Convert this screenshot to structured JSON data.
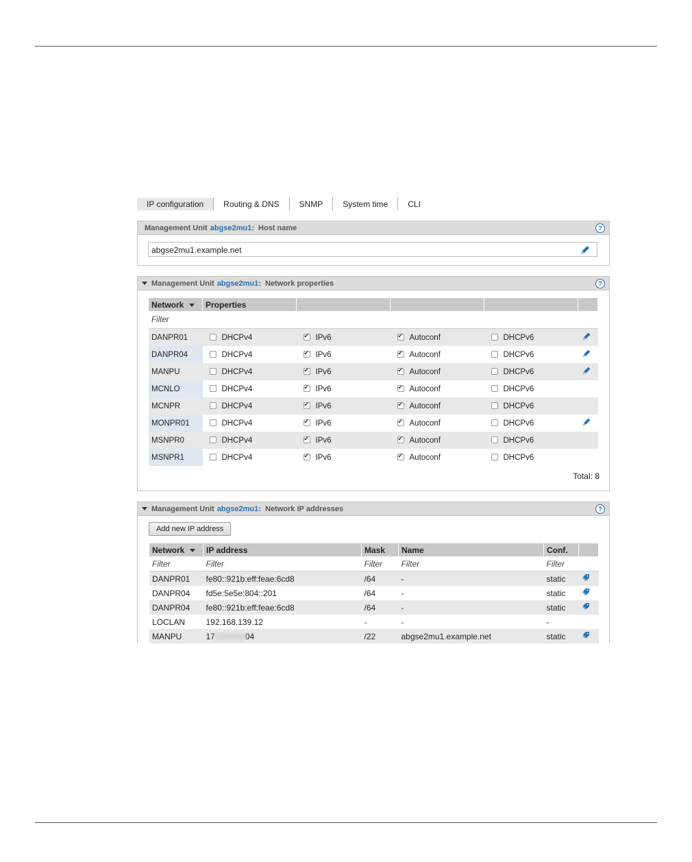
{
  "tabs": [
    "IP configuration",
    "Routing & DNS",
    "SNMP",
    "System time",
    "CLI"
  ],
  "host_panel": {
    "title_prefix": "Management Unit",
    "unit": "abgse2mu1",
    "title_suffix": ":  Host name",
    "host_value": "abgse2mu1.example.net"
  },
  "netprops_panel": {
    "title_prefix": "Management Unit",
    "unit": "abgse2mu1",
    "title_suffix": ":  Network properties",
    "col_network": "Network",
    "col_properties": "Properties",
    "filter_label": "Filter",
    "total": "Total: 8",
    "rows": [
      {
        "network": "DANPR01",
        "dhcpv4": false,
        "ipv6": true,
        "autoconf": true,
        "dhcpv6": false,
        "editable": true
      },
      {
        "network": "DANPR04",
        "dhcpv4": false,
        "ipv6": true,
        "autoconf": true,
        "dhcpv6": false,
        "editable": true
      },
      {
        "network": "MANPU",
        "dhcpv4": false,
        "ipv6": true,
        "autoconf": true,
        "dhcpv6": false,
        "editable": true
      },
      {
        "network": "MCNLO",
        "dhcpv4": false,
        "ipv6": true,
        "autoconf": true,
        "dhcpv6": false,
        "editable": false
      },
      {
        "network": "MCNPR",
        "dhcpv4": false,
        "ipv6": true,
        "autoconf": true,
        "dhcpv6": false,
        "editable": false
      },
      {
        "network": "MONPR01",
        "dhcpv4": false,
        "ipv6": true,
        "autoconf": true,
        "dhcpv6": false,
        "editable": true
      },
      {
        "network": "MSNPR0",
        "dhcpv4": false,
        "ipv6": true,
        "autoconf": true,
        "dhcpv6": false,
        "editable": false
      },
      {
        "network": "MSNPR1",
        "dhcpv4": false,
        "ipv6": true,
        "autoconf": true,
        "dhcpv6": false,
        "editable": false
      }
    ],
    "labels": {
      "dhcpv4": "DHCPv4",
      "ipv6": "IPv6",
      "autoconf": "Autoconf",
      "dhcpv6": "DHCPv6"
    }
  },
  "ipaddr_panel": {
    "title_prefix": "Management Unit",
    "unit": "abgse2mu1",
    "title_suffix": ":  Network IP addresses",
    "add_button": "Add new IP address",
    "columns": [
      "Network",
      "IP address",
      "Mask",
      "Name",
      "Conf."
    ],
    "filters": [
      "Filter",
      "Filter",
      "Filter",
      "Filter",
      "Filter"
    ],
    "rows": [
      {
        "network": "DANPR01",
        "ip": "fe80::921b:eff:feae:6cd8",
        "mask": "/64",
        "name": "-",
        "conf": "static",
        "edit": true
      },
      {
        "network": "DANPR04",
        "ip": "fd5e:5e5e:804::201",
        "mask": "/64",
        "name": "-",
        "conf": "static",
        "edit": true
      },
      {
        "network": "DANPR04",
        "ip": "fe80::921b:eff:feae:6cd8",
        "mask": "/64",
        "name": "-",
        "conf": "static",
        "edit": true
      },
      {
        "network": "LOCLAN",
        "ip": "192.168.139.12",
        "mask": "-",
        "name": "-",
        "conf": "-",
        "edit": false
      },
      {
        "network": "MANPU",
        "ip_prefix": "17",
        "ip_suffix": "04",
        "mask": "/22",
        "name": "abgse2mu1.example.net",
        "conf": "static",
        "edit": true
      }
    ]
  },
  "colors": {
    "accent": "#2a6fb0",
    "header_bg": "#dcdcdc",
    "table_header": "#c8c8c8",
    "network_cell": "#dfe7f1"
  }
}
